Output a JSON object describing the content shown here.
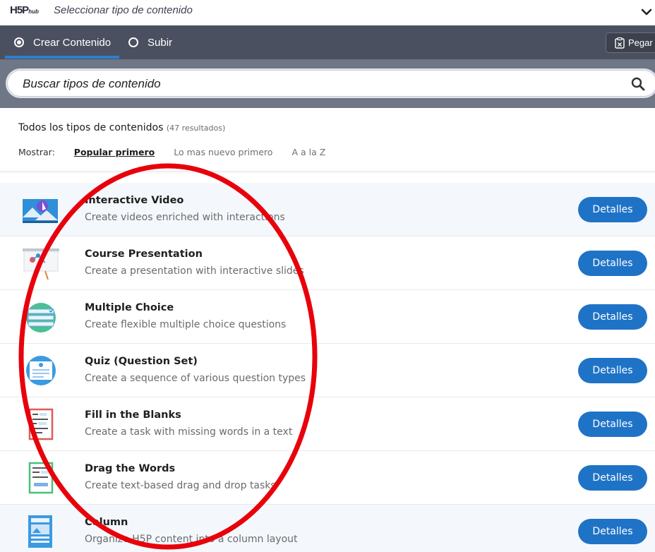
{
  "header": {
    "logo_main": "H5P",
    "logo_sub": "hub",
    "title": "Seleccionar tipo de contenido"
  },
  "tabs": {
    "create_label": "Crear Contenido",
    "upload_label": "Subir",
    "paste_label": "Pegar"
  },
  "search": {
    "placeholder": "Buscar tipos de contenido"
  },
  "results": {
    "title": "Todos los tipos de contenidos",
    "count": "(47 resultados)",
    "show_label": "Mostrar:",
    "sort_options": [
      "Popular primero",
      "Lo mas nuevo primero",
      "A a la Z"
    ]
  },
  "content_types": [
    {
      "name": "Interactive Video",
      "description": "Create videos enriched with interactions",
      "button": "Detalles",
      "icon": "interactive-video-icon"
    },
    {
      "name": "Course Presentation",
      "description": "Create a presentation with interactive slides",
      "button": "Detalles",
      "icon": "course-presentation-icon"
    },
    {
      "name": "Multiple Choice",
      "description": "Create flexible multiple choice questions",
      "button": "Detalles",
      "icon": "multiple-choice-icon"
    },
    {
      "name": "Quiz (Question Set)",
      "description": "Create a sequence of various question types",
      "button": "Detalles",
      "icon": "question-set-icon"
    },
    {
      "name": "Fill in the Blanks",
      "description": "Create a task with missing words in a text",
      "button": "Detalles",
      "icon": "fill-in-the-blanks-icon"
    },
    {
      "name": "Drag the Words",
      "description": "Create text-based drag and drop tasks",
      "button": "Detalles",
      "icon": "drag-the-words-icon"
    },
    {
      "name": "Column",
      "description": "Organize H5P content into a column layout",
      "button": "Detalles",
      "icon": "column-icon"
    }
  ],
  "colors": {
    "tabbar": "#4b5060",
    "search_area": "#6f7686",
    "button": "#1f73c6",
    "annotation": "#e8000b"
  }
}
